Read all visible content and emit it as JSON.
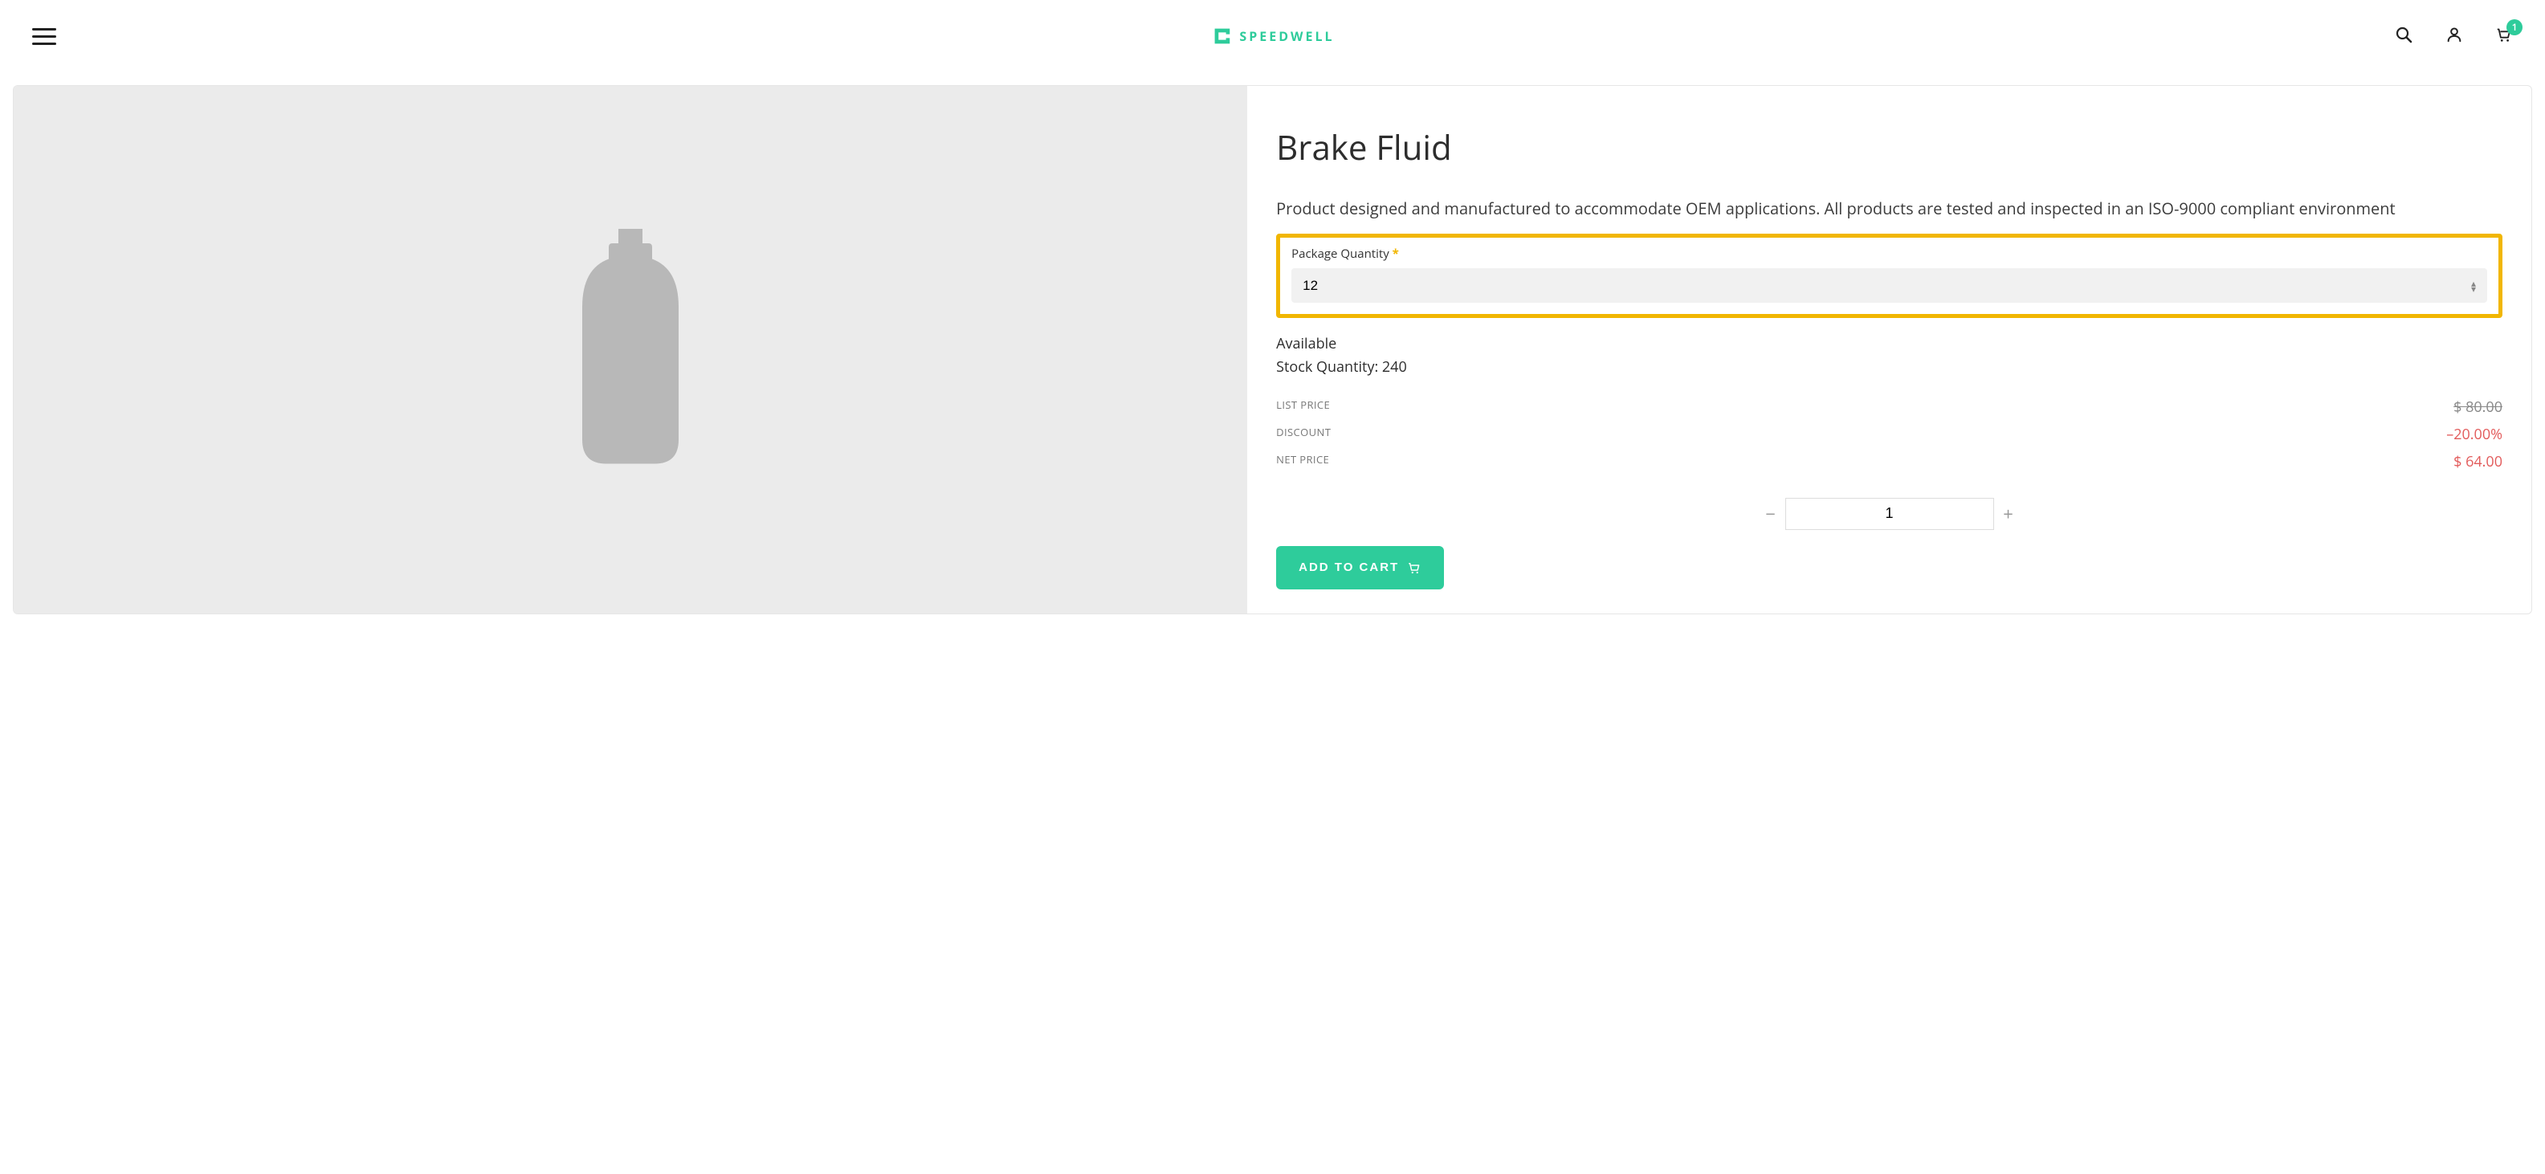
{
  "header": {
    "brand": "SPEEDWELL",
    "cart_count": "1"
  },
  "product": {
    "title": "Brake Fluid",
    "description": "Product designed and manufactured to accommodate OEM applications. All products are tested and inspected in an ISO-9000 compliant environment",
    "package_qty_label": "Package Quantity",
    "package_qty_value": "12",
    "availability_label": "Available",
    "stock_label": "Stock Quantity: 240",
    "prices": {
      "list_label": "LIST PRICE",
      "list_value": "$ 80.00",
      "discount_label": "DISCOUNT",
      "discount_value": "–20.00%",
      "net_label": "NET PRICE",
      "net_value": "$ 64.00"
    },
    "quantity_value": "1",
    "add_to_cart_label": "ADD TO CART"
  }
}
